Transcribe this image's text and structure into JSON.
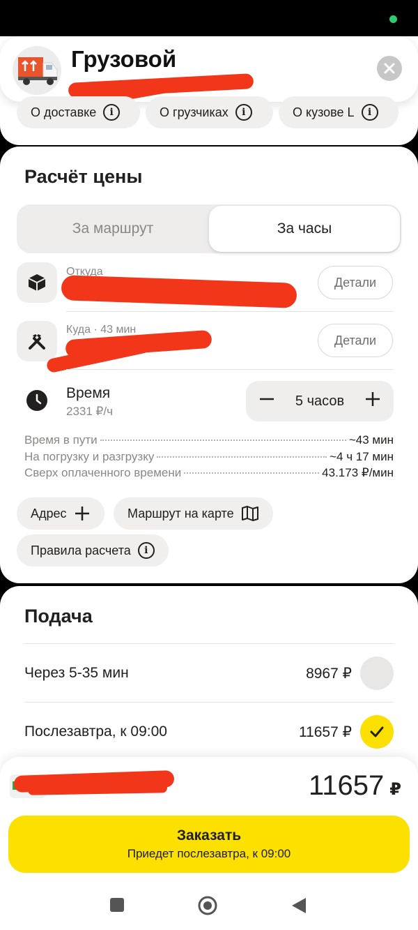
{
  "header": {
    "title": "Грузовой",
    "chips": [
      "О доставке",
      "О грузчиках",
      "О кузове L"
    ]
  },
  "price": {
    "title": "Расчёт цены",
    "tabs": {
      "route": "За маршрут",
      "hours": "За часы"
    },
    "from_label": "Откуда",
    "to_label": "Куда · 43 мин",
    "details_label": "Детали",
    "time_label": "Время",
    "time_rate": "2331 ₽/ч",
    "stepper_value": "5 часов",
    "info": [
      {
        "label": "Время в пути",
        "value": "~43 мин"
      },
      {
        "label": "На погрузку и разгрузку",
        "value": "~4 ч 17 мин"
      },
      {
        "label": "Сверх оплаченного времени",
        "value": "43.173 ₽/мин"
      }
    ],
    "address_label": "Адрес",
    "map_label": "Маршрут на карте",
    "rules_label": "Правила расчета"
  },
  "delivery": {
    "title": "Подача",
    "options": [
      {
        "label": "Через 5-35 мин",
        "price": "8967 ₽",
        "selected": false
      },
      {
        "label": "Послезавтра, к 09:00",
        "price": "11657 ₽",
        "selected": true
      }
    ]
  },
  "order": {
    "total_value": "11657",
    "currency": "₽",
    "button_title": "Заказать",
    "button_sub": "Приедет послезавтра, к 09:00"
  },
  "colors": {
    "accent": "#fce000",
    "status_dot": "#2ecc71",
    "redaction": "#f2361a"
  }
}
